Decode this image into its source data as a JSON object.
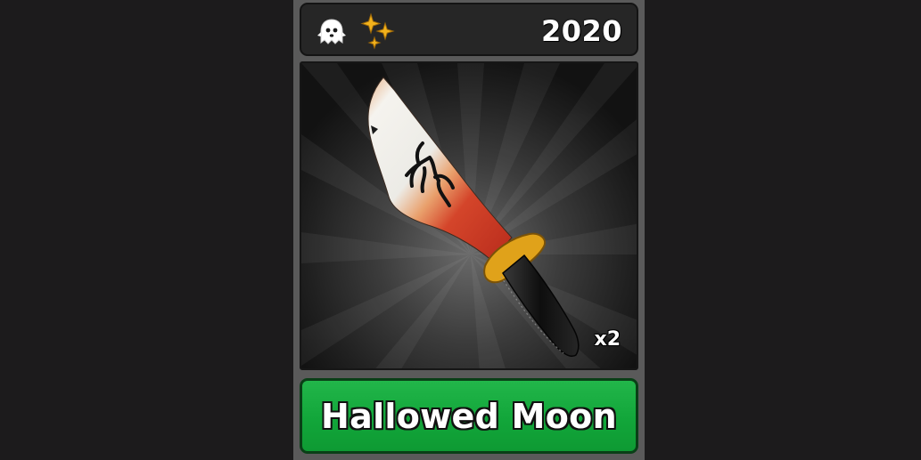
{
  "item_card": {
    "badges": [
      "ghost-icon",
      "sparkle-icon"
    ],
    "year": "2020",
    "quantity": "x2",
    "name": "Hallowed Moon",
    "item_kind": "knife",
    "colors": {
      "card_frame": "#5a5a5a",
      "header_bg": "#262626",
      "name_plate": "#12a63a",
      "badge_gold": "#f2b21c",
      "blade_white": "#f2f0ea",
      "blade_red": "#c4321f",
      "guard_gold": "#e0a21a",
      "handle_black": "#141414"
    }
  }
}
